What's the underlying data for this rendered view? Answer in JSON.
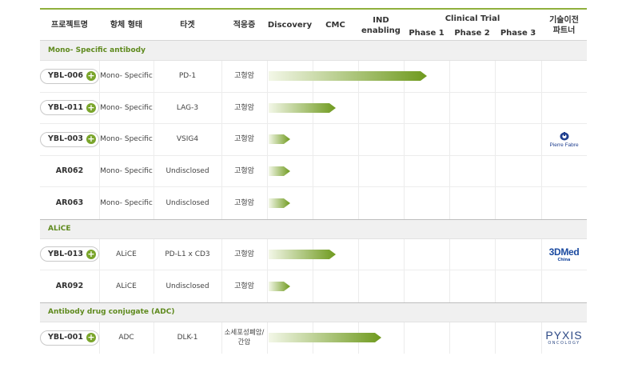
{
  "header": {
    "project": "프로젝트명",
    "format": "항체 형태",
    "target": "타겟",
    "indication": "적응증",
    "discovery": "Discovery",
    "cmc": "CMC",
    "ind_line1": "IND",
    "ind_line2": "enabling",
    "clinical_trial": "Clinical Trial",
    "phase1": "Phase 1",
    "phase2": "Phase 2",
    "phase3": "Phase 3",
    "partner_line1": "기술이전",
    "partner_line2": "파트너"
  },
  "sections": [
    {
      "title": "Mono- Specific antibody",
      "rows": [
        {
          "code": "YBL-006",
          "expandable": true,
          "format": "Mono- Specific",
          "target": "PD-1",
          "indication": "고형암",
          "progress_stage": "Phase 1",
          "partner": ""
        },
        {
          "code": "YBL-011",
          "expandable": true,
          "format": "Mono- Specific",
          "target": "LAG-3",
          "indication": "고형암",
          "progress_stage": "CMC",
          "partner": ""
        },
        {
          "code": "YBL-003",
          "expandable": true,
          "format": "Mono- Specific",
          "target": "VSIG4",
          "indication": "고형암",
          "progress_stage": "Discovery",
          "partner": "Pierre Fabre"
        },
        {
          "code": "AR062",
          "expandable": false,
          "format": "Mono- Specific",
          "target": "Undisclosed",
          "indication": "고형암",
          "progress_stage": "Discovery",
          "partner": ""
        },
        {
          "code": "AR063",
          "expandable": false,
          "format": "Mono- Specific",
          "target": "Undisclosed",
          "indication": "고형암",
          "progress_stage": "Discovery",
          "partner": ""
        }
      ]
    },
    {
      "title": "ALiCE",
      "rows": [
        {
          "code": "YBL-013",
          "expandable": true,
          "format": "ALiCE",
          "target": "PD-L1 x CD3",
          "indication": "고형암",
          "progress_stage": "CMC",
          "partner": "3DMed China"
        },
        {
          "code": "AR092",
          "expandable": false,
          "format": "ALiCE",
          "target": "Undisclosed",
          "indication": "고형암",
          "progress_stage": "Discovery",
          "partner": ""
        }
      ]
    },
    {
      "title": "Antibody drug conjugate (ADC)",
      "rows": [
        {
          "code": "YBL-001",
          "expandable": true,
          "format": "ADC",
          "target": "DLK-1",
          "indication": "소세포성폐암/\n간암",
          "progress_stage": "IND enabling",
          "partner": "PYXIS ONCOLOGY"
        }
      ]
    }
  ],
  "partners": {
    "pierre_fabre": "Pierre Fabre",
    "threedmed_main": "3DMed",
    "threedmed_sub": "China",
    "pyxis_main": "PYXIS",
    "pyxis_sub": "ONCOLOGY"
  },
  "colors": {
    "accent_green": "#7aa52b",
    "bar_start": "#f3f7e8",
    "bar_end": "#6f9a1e",
    "section_text": "#5f8a1e",
    "section_bg": "#f0f0f0",
    "pierre_fabre_blue": "#1f3f8f",
    "threedmed_blue": "#1b4aa0",
    "threedmed_red": "#d81f26",
    "pyxis_blue": "#2e4a86",
    "pyxis_accent": "#cf3b66"
  }
}
